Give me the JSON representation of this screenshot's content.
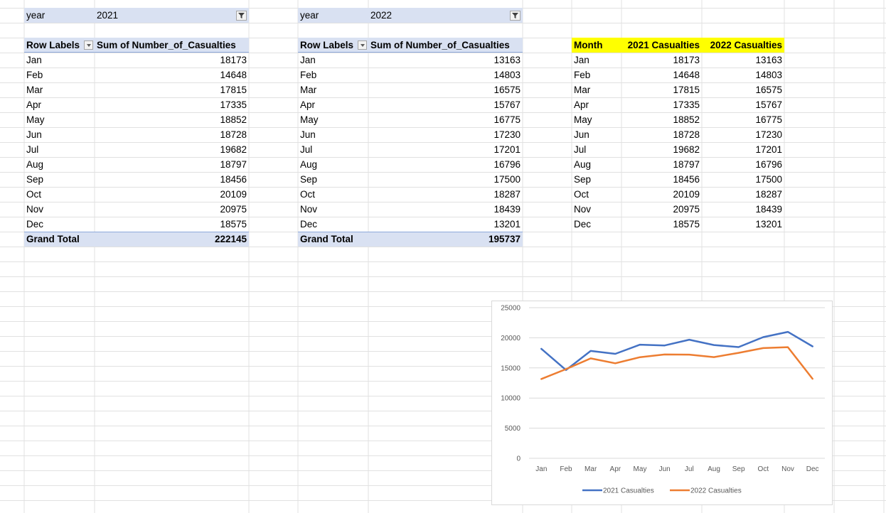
{
  "pivot1": {
    "filter_label": "year",
    "filter_value": "2021",
    "row_labels_header": "Row Labels",
    "sum_header": "Sum of Number_of_Casualties",
    "rows": [
      {
        "month": "Jan",
        "value": "18173"
      },
      {
        "month": "Feb",
        "value": "14648"
      },
      {
        "month": "Mar",
        "value": "17815"
      },
      {
        "month": "Apr",
        "value": "17335"
      },
      {
        "month": "May",
        "value": "18852"
      },
      {
        "month": "Jun",
        "value": "18728"
      },
      {
        "month": "Jul",
        "value": "19682"
      },
      {
        "month": "Aug",
        "value": "18797"
      },
      {
        "month": "Sep",
        "value": "18456"
      },
      {
        "month": "Oct",
        "value": "20109"
      },
      {
        "month": "Nov",
        "value": "20975"
      },
      {
        "month": "Dec",
        "value": "18575"
      }
    ],
    "grand_total_label": "Grand Total",
    "grand_total_value": "222145"
  },
  "pivot2": {
    "filter_label": "year",
    "filter_value": "2022",
    "row_labels_header": "Row Labels",
    "sum_header": "Sum of Number_of_Casualties",
    "rows": [
      {
        "month": "Jan",
        "value": "13163"
      },
      {
        "month": "Feb",
        "value": "14803"
      },
      {
        "month": "Mar",
        "value": "16575"
      },
      {
        "month": "Apr",
        "value": "15767"
      },
      {
        "month": "May",
        "value": "16775"
      },
      {
        "month": "Jun",
        "value": "17230"
      },
      {
        "month": "Jul",
        "value": "17201"
      },
      {
        "month": "Aug",
        "value": "16796"
      },
      {
        "month": "Sep",
        "value": "17500"
      },
      {
        "month": "Oct",
        "value": "18287"
      },
      {
        "month": "Nov",
        "value": "18439"
      },
      {
        "month": "Dec",
        "value": "13201"
      }
    ],
    "grand_total_label": "Grand Total",
    "grand_total_value": "195737"
  },
  "summary": {
    "headers": [
      "Month",
      "2021 Casualties",
      "2022 Casualties"
    ],
    "header_color": "#ffff00",
    "rows": [
      [
        "Jan",
        "18173",
        "13163"
      ],
      [
        "Feb",
        "14648",
        "14803"
      ],
      [
        "Mar",
        "17815",
        "16575"
      ],
      [
        "Apr",
        "17335",
        "15767"
      ],
      [
        "May",
        "18852",
        "16775"
      ],
      [
        "Jun",
        "18728",
        "17230"
      ],
      [
        "Jul",
        "19682",
        "17201"
      ],
      [
        "Aug",
        "18797",
        "16796"
      ],
      [
        "Sep",
        "18456",
        "17500"
      ],
      [
        "Oct",
        "20109",
        "18287"
      ],
      [
        "Nov",
        "20975",
        "18439"
      ],
      [
        "Dec",
        "18575",
        "13201"
      ]
    ]
  },
  "icons": {
    "filter_button": "filter-funnel-icon",
    "dropdown_button": "chevron-down-icon"
  },
  "chart_data": {
    "type": "line",
    "categories": [
      "Jan",
      "Feb",
      "Mar",
      "Apr",
      "May",
      "Jun",
      "Jul",
      "Aug",
      "Sep",
      "Oct",
      "Nov",
      "Dec"
    ],
    "series": [
      {
        "name": "2021 Casualties",
        "color": "#4472c4",
        "values": [
          18173,
          14648,
          17815,
          17335,
          18852,
          18728,
          19682,
          18797,
          18456,
          20109,
          20975,
          18575
        ]
      },
      {
        "name": "2022 Casualties",
        "color": "#ed7d31",
        "values": [
          13163,
          14803,
          16575,
          15767,
          16775,
          17230,
          17201,
          16796,
          17500,
          18287,
          18439,
          13201
        ]
      }
    ],
    "yticks": [
      "0",
      "5000",
      "10000",
      "15000",
      "20000",
      "25000"
    ],
    "ylim": [
      0,
      25000
    ],
    "grid": true,
    "legend": "bottom"
  }
}
